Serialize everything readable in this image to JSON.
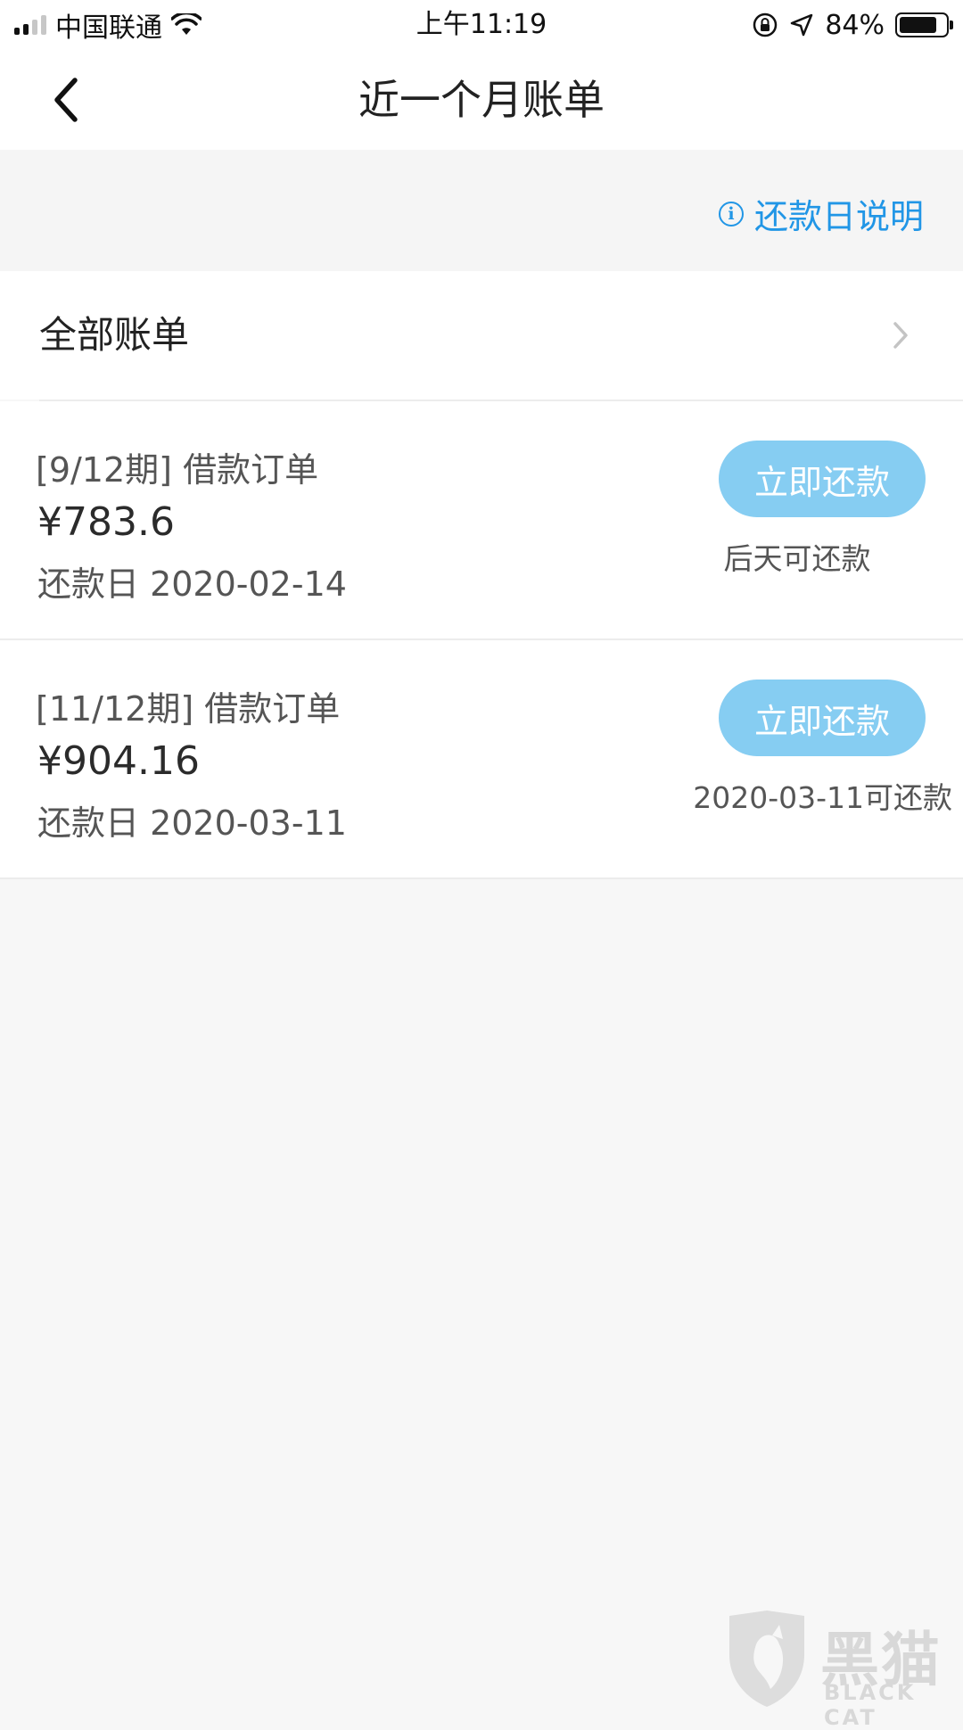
{
  "status_bar": {
    "carrier": "中国联通",
    "time": "上午11:19",
    "battery_percent": "84%",
    "battery_level": 0.84,
    "icons": [
      "signal-icon",
      "wifi-icon",
      "rotation-lock-icon",
      "location-icon",
      "battery-icon"
    ]
  },
  "nav": {
    "title": "近一个月账单",
    "back_icon": "chevron-left-icon"
  },
  "info": {
    "repay_day_link": "还款日说明",
    "icon": "info-icon",
    "color": "#2196e6"
  },
  "all_bills": {
    "label": "全部账单",
    "icon": "chevron-right-icon"
  },
  "bills": [
    {
      "period": "[9/12期] 借款订单",
      "amount": "¥783.6",
      "due": "还款日 2020-02-14",
      "button": "立即还款",
      "hint": "后天可还款"
    },
    {
      "period": "[11/12期] 借款订单",
      "amount": "¥904.16",
      "due": "还款日 2020-03-11",
      "button": "立即还款",
      "hint": "2020-03-11可还款"
    }
  ],
  "colors": {
    "accent": "#2196e6",
    "button": "#86cdf2"
  },
  "watermark": {
    "brand": "黑猫",
    "sub": "BLACK CAT"
  }
}
